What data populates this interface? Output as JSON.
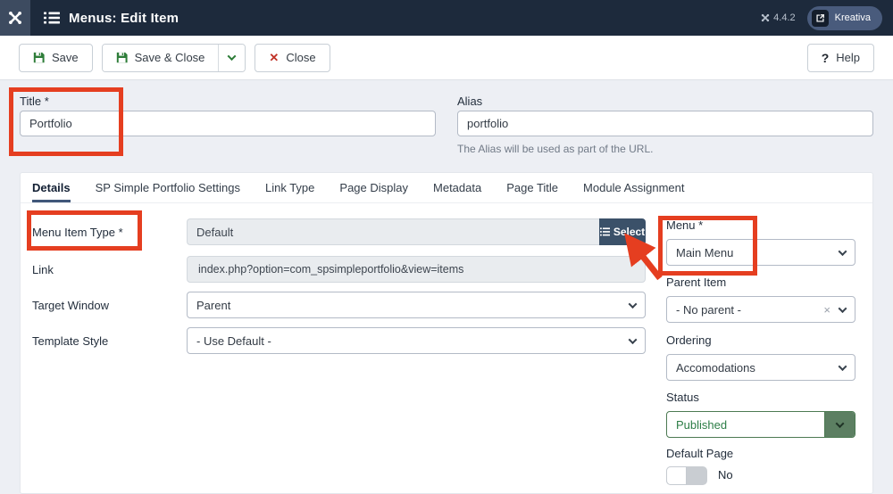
{
  "colors": {
    "header_bg": "#1d2a3c",
    "annotation_red": "#e53e20",
    "select_button_bg": "#3b5169",
    "status_green": "#2e7d46",
    "page_bg": "#edeff4"
  },
  "header": {
    "title": "Menus: Edit Item",
    "version": "4.4.2",
    "account": "Kreativa"
  },
  "toolbar": {
    "save": "Save",
    "save_and_close": "Save & Close",
    "close": "Close",
    "help": "Help"
  },
  "fields": {
    "title": {
      "label": "Title *",
      "value": "Portfolio"
    },
    "alias": {
      "label": "Alias",
      "value": "portfolio",
      "help": "The Alias will be used as part of the URL."
    }
  },
  "tabs": [
    {
      "label": "Details",
      "active": true
    },
    {
      "label": "SP Simple Portfolio Settings",
      "active": false
    },
    {
      "label": "Link Type",
      "active": false
    },
    {
      "label": "Page Display",
      "active": false
    },
    {
      "label": "Metadata",
      "active": false
    },
    {
      "label": "Page Title",
      "active": false
    },
    {
      "label": "Module Assignment",
      "active": false
    }
  ],
  "details_form": {
    "menu_item_type": {
      "label": "Menu Item Type *",
      "value": "Default",
      "button": "Select"
    },
    "link": {
      "label": "Link",
      "value": "index.php?option=com_spsimpleportfolio&view=items"
    },
    "target_window": {
      "label": "Target Window",
      "value": "Parent"
    },
    "template_style": {
      "label": "Template Style",
      "value": "- Use Default -"
    }
  },
  "sidebar": {
    "menu": {
      "label": "Menu *",
      "value": "Main Menu"
    },
    "parent_item": {
      "label": "Parent Item",
      "value": "- No parent -"
    },
    "ordering": {
      "label": "Ordering",
      "value": "Accomodations"
    },
    "status": {
      "label": "Status",
      "value": "Published"
    },
    "default_page": {
      "label": "Default Page",
      "value": "No"
    }
  },
  "icons": {
    "close_glyph": "✕",
    "help_glyph": "?",
    "clear_glyph": "×"
  }
}
